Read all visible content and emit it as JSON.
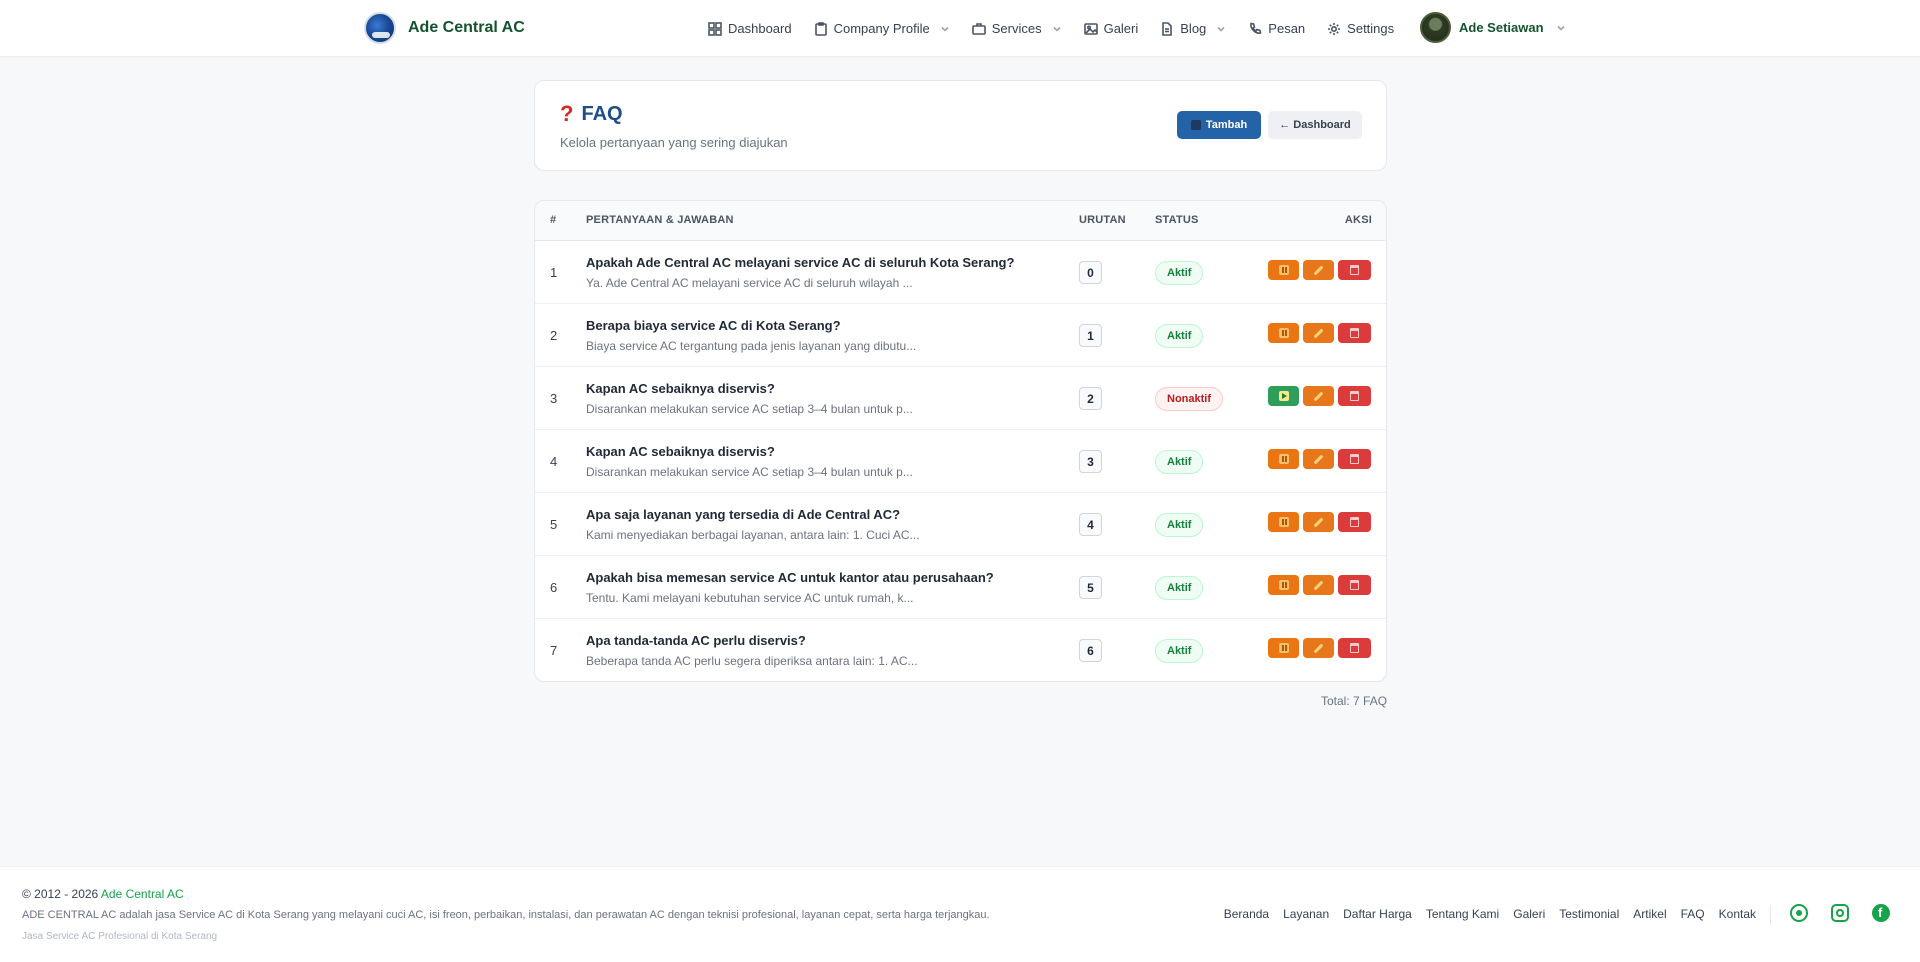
{
  "nav": {
    "brand": "Ade Central AC",
    "items": [
      {
        "label": "Dashboard",
        "icon": "grid-icon",
        "dropdown": false
      },
      {
        "label": "Company Profile",
        "icon": "clipboard-icon",
        "dropdown": true
      },
      {
        "label": "Services",
        "icon": "briefcase-icon",
        "dropdown": true
      },
      {
        "label": "Galeri",
        "icon": "image-icon",
        "dropdown": false
      },
      {
        "label": "Blog",
        "icon": "file-icon",
        "dropdown": true
      },
      {
        "label": "Pesan",
        "icon": "phone-icon",
        "dropdown": false
      },
      {
        "label": "Settings",
        "icon": "gear-icon",
        "dropdown": false
      }
    ],
    "user": "Ade Setiawan"
  },
  "header": {
    "title": "FAQ",
    "subtitle": "Kelola pertanyaan yang sering diajukan",
    "add_label": "Tambah",
    "back_label": "← Dashboard"
  },
  "table": {
    "columns": {
      "num": "#",
      "qa": "PERTANYAAN & JAWABAN",
      "order": "URUTAN",
      "status": "STATUS",
      "actions": "AKSI"
    },
    "rows": [
      {
        "num": "1",
        "question": "Apakah Ade Central AC melayani service AC di seluruh Kota Serang?",
        "answer": "Ya. Ade Central AC melayani service AC di seluruh wilayah ...",
        "order": "0",
        "status": "Aktif",
        "active": true
      },
      {
        "num": "2",
        "question": "Berapa biaya service AC di Kota Serang?",
        "answer": "Biaya service AC tergantung pada jenis layanan yang dibutu...",
        "order": "1",
        "status": "Aktif",
        "active": true
      },
      {
        "num": "3",
        "question": "Kapan AC sebaiknya diservis?",
        "answer": "Disarankan melakukan service AC setiap 3–4 bulan untuk p...",
        "order": "2",
        "status": "Nonaktif",
        "active": false
      },
      {
        "num": "4",
        "question": "Kapan AC sebaiknya diservis?",
        "answer": "Disarankan melakukan service AC setiap 3–4 bulan untuk p...",
        "order": "3",
        "status": "Aktif",
        "active": true
      },
      {
        "num": "5",
        "question": "Apa saja layanan yang tersedia di Ade Central AC?",
        "answer": "Kami menyediakan berbagai layanan, antara lain: 1. Cuci AC...",
        "order": "4",
        "status": "Aktif",
        "active": true
      },
      {
        "num": "6",
        "question": "Apakah bisa memesan service AC untuk kantor atau perusahaan?",
        "answer": "Tentu. Kami melayani kebutuhan service AC untuk rumah, k...",
        "order": "5",
        "status": "Aktif",
        "active": true
      },
      {
        "num": "7",
        "question": "Apa tanda-tanda AC perlu diservis?",
        "answer": "Beberapa tanda AC perlu segera diperiksa antara lain: 1. AC...",
        "order": "6",
        "status": "Aktif",
        "active": true
      }
    ],
    "total": "Total: 7 FAQ"
  },
  "footer": {
    "copyright_prefix": "© 2012 - 2026 ",
    "copyright_brand": "Ade Central AC",
    "description": "ADE CENTRAL AC adalah jasa Service AC di Kota Serang yang melayani cuci AC, isi freon, perbaikan, instalasi, dan perawatan AC dengan teknisi profesional, layanan cepat, serta harga terjangkau.",
    "tagline": "Jasa Service AC Profesional di Kota Serang",
    "links": [
      "Beranda",
      "Layanan",
      "Daftar Harga",
      "Tentang Kami",
      "Galeri",
      "Testimonial",
      "Artikel",
      "FAQ",
      "Kontak"
    ],
    "socials": [
      "whatsapp-icon",
      "instagram-icon",
      "facebook-icon"
    ]
  },
  "colors": {
    "brand_green": "#16a34a",
    "title_blue": "#1d4e89",
    "primary_button": "#2563a8",
    "toggle_orange": "#ea7512",
    "toggle_green": "#2f9e5b",
    "delete_red": "#dc3b3b"
  }
}
